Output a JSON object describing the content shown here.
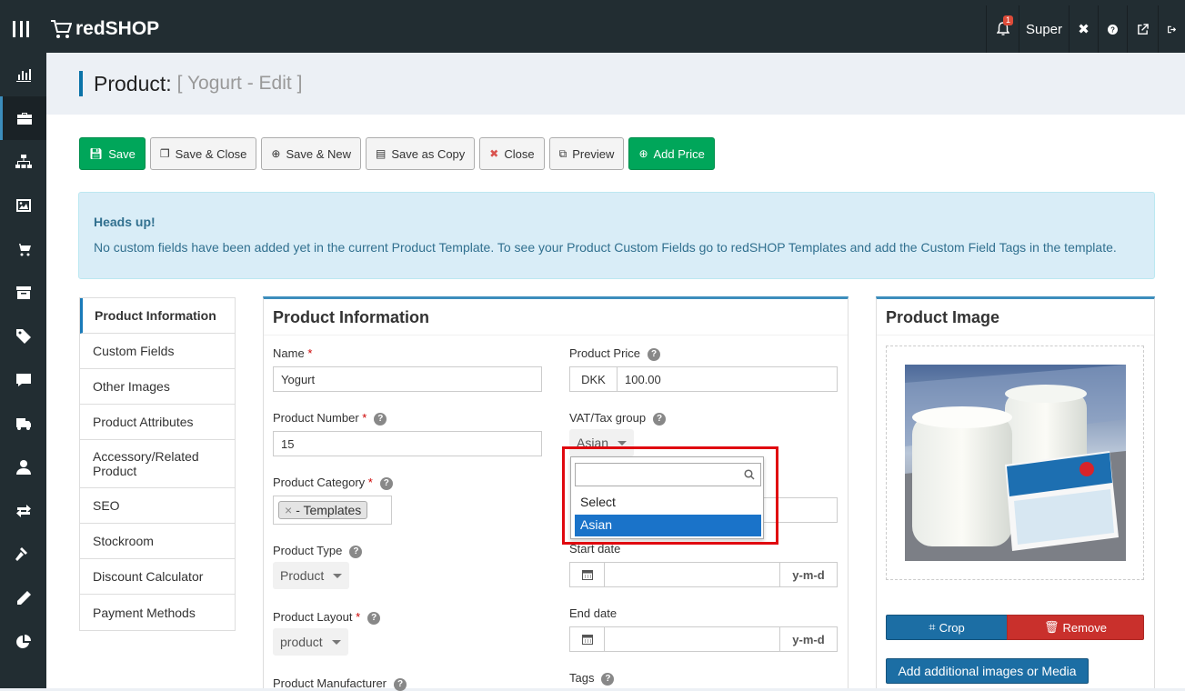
{
  "app": {
    "name": "redSHOP"
  },
  "topbar": {
    "notification_count": "1",
    "user": "Super"
  },
  "sidebar_icons": [
    "chart-icon",
    "briefcase-icon",
    "sitemap-icon",
    "image-icon",
    "cart-icon",
    "archive-icon",
    "tag-icon",
    "comment-icon",
    "truck-icon",
    "user-icon",
    "exchange-icon",
    "gavel-icon",
    "pencil-icon",
    "pie-chart-icon"
  ],
  "header": {
    "title": "Product:",
    "subtitle": "[ Yogurt - Edit ]"
  },
  "toolbar": {
    "save": "Save",
    "save_close": "Save & Close",
    "save_new": "Save & New",
    "save_copy": "Save as Copy",
    "close": "Close",
    "preview": "Preview",
    "add_price": "Add Price"
  },
  "alert": {
    "heading": "Heads up!",
    "body": "No custom fields have been added yet in the current Product Template. To see your Product Custom Fields go to redSHOP Templates and add the Custom Field Tags in the template."
  },
  "tabs": [
    "Product Information",
    "Custom Fields",
    "Other Images",
    "Product Attributes",
    "Accessory/Related Product",
    "SEO",
    "Stockroom",
    "Discount Calculator",
    "Payment Methods"
  ],
  "form": {
    "section_title": "Product Information",
    "name_label": "Name",
    "name_value": "Yogurt",
    "number_label": "Product Number",
    "number_value": "15",
    "category_label": "Product Category",
    "category_value": "- Templates",
    "type_label": "Product Type",
    "type_value": "Product",
    "layout_label": "Product Layout",
    "layout_value": "product",
    "manufacturer_label": "Product Manufacturer",
    "price_label": "Product Price",
    "currency": "DKK",
    "price_value": "100.00",
    "vat_label": "VAT/Tax group",
    "vat_value": "Asian",
    "start_label": "Start date",
    "end_label": "End date",
    "date_format": "y-m-d",
    "tags_label": "Tags"
  },
  "vat_dropdown": {
    "options": [
      "Select",
      "Asian"
    ],
    "highlighted": "Asian"
  },
  "image_panel": {
    "title": "Product Image",
    "crop": "Crop",
    "remove": "Remove",
    "add_media": "Add additional images or Media"
  },
  "colors": {
    "accent": "#3c8dbc",
    "success": "#00a65a",
    "danger": "#c9302c",
    "highlight_outline": "#e0080f"
  }
}
